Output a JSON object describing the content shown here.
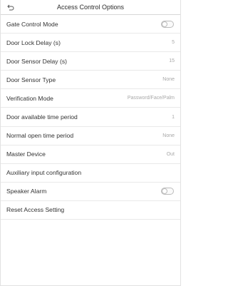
{
  "header": {
    "title": "Access Control Options"
  },
  "rows": [
    {
      "label": "Gate Control Mode",
      "type": "toggle",
      "on": false
    },
    {
      "label": "Door Lock Delay (s)",
      "type": "value",
      "value": "5"
    },
    {
      "label": "Door Sensor Delay (s)",
      "type": "value",
      "value": "15"
    },
    {
      "label": "Door Sensor Type",
      "type": "value",
      "value": "None"
    },
    {
      "label": "Verification Mode",
      "type": "value",
      "value": "Password/Face/Palm"
    },
    {
      "label": "Door available time period",
      "type": "value",
      "value": "1"
    },
    {
      "label": "Normal open time period",
      "type": "value",
      "value": "None"
    },
    {
      "label": "Master Device",
      "type": "value",
      "value": "Out"
    },
    {
      "label": "Auxiliary input configuration",
      "type": "none"
    },
    {
      "label": "Speaker Alarm",
      "type": "toggle",
      "on": false
    },
    {
      "label": "Reset Access Setting",
      "type": "none"
    }
  ]
}
